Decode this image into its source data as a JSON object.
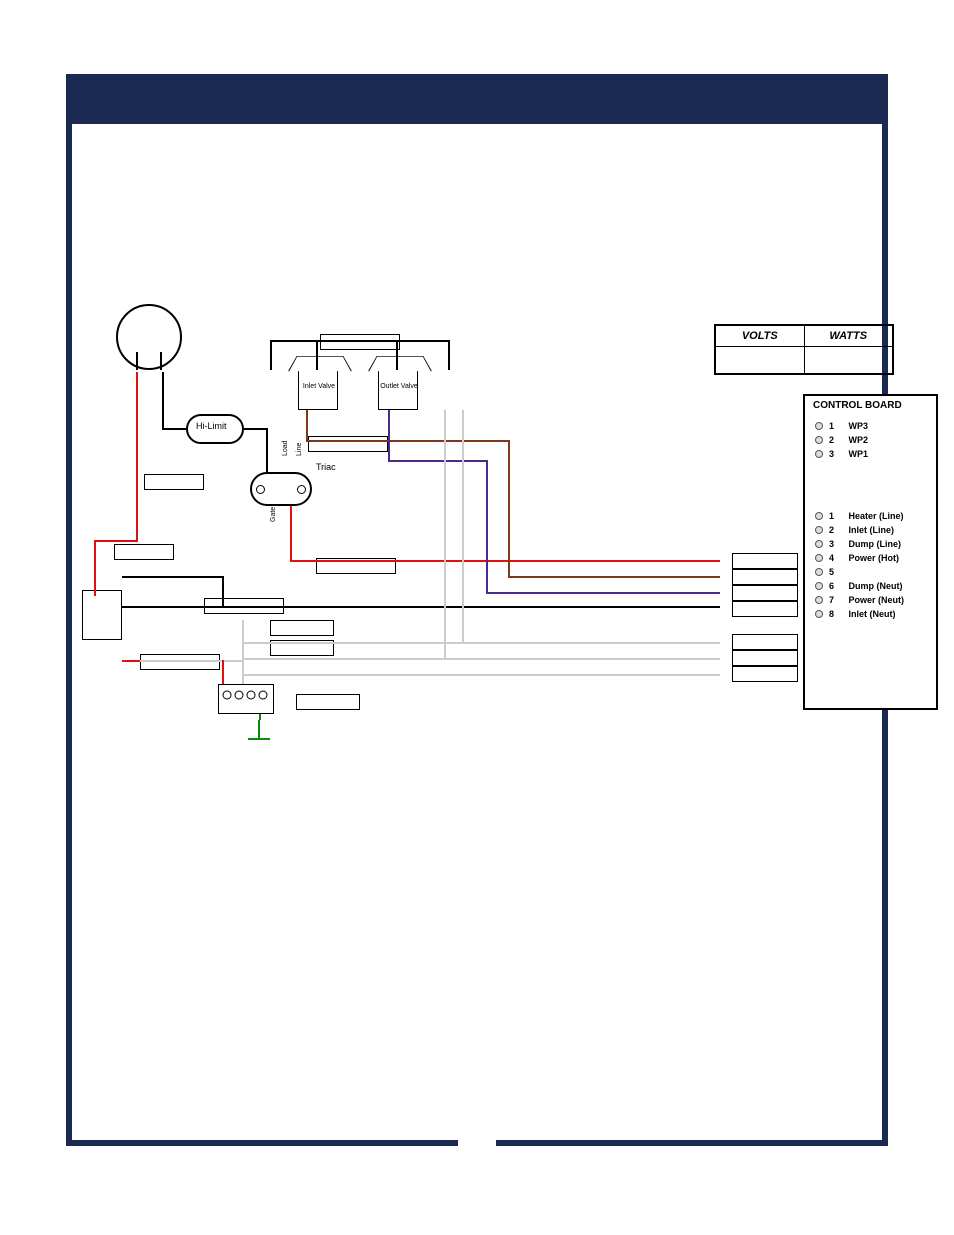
{
  "vw_table": {
    "headers": [
      "VOLTS",
      "WATTS"
    ],
    "row": [
      "",
      ""
    ]
  },
  "control_board": {
    "title": "CONTROL BOARD",
    "top_rows": [
      {
        "num": "1",
        "label": "WP3"
      },
      {
        "num": "2",
        "label": "WP2"
      },
      {
        "num": "3",
        "label": "WP1"
      }
    ],
    "bottom_rows": [
      {
        "num": "1",
        "label": "Heater (Line)"
      },
      {
        "num": "2",
        "label": "Inlet (Line)"
      },
      {
        "num": "3",
        "label": "Dump (Line)"
      },
      {
        "num": "4",
        "label": "Power (Hot)"
      },
      {
        "num": "5",
        "label": ""
      },
      {
        "num": "6",
        "label": "Dump (Neut)"
      },
      {
        "num": "7",
        "label": "Power (Neut)"
      },
      {
        "num": "8",
        "label": "Inlet (Neut)"
      }
    ]
  },
  "components": {
    "hi_limit": "Hi-Limit",
    "triac": "Triac",
    "triac_load": "Load",
    "triac_line": "Line",
    "triac_gate": "Gate",
    "inlet_valve": "Inlet\nValve",
    "outlet_valve": "Outlet\nValve"
  },
  "wires": {
    "heater_line": {
      "color": "red",
      "desc": "Heater element through Hi-Limit and Triac to CB pin 1 Heater (Line)"
    },
    "inlet_line": {
      "color": "brown",
      "desc": "Inlet valve to CB pin 2 Inlet (Line)"
    },
    "dump_line": {
      "color": "purple",
      "desc": "Outlet/Dump valve to CB pin 3 Dump (Line)"
    },
    "power_hot": {
      "color": "black",
      "desc": "Power switch hot leg to CB pin 4 Power (Hot)"
    },
    "dump_neut": {
      "color": "white",
      "desc": "Dump valve neutral to CB pin 6 Dump (Neut)"
    },
    "power_neut": {
      "color": "white",
      "desc": "Neutral bus to CB pin 7 Power (Neut)"
    },
    "inlet_neut": {
      "color": "white",
      "desc": "Inlet valve neutral to CB pin 8 Inlet (Neut)"
    },
    "ground": {
      "color": "green",
      "desc": "Chassis ground from terminal block"
    }
  }
}
